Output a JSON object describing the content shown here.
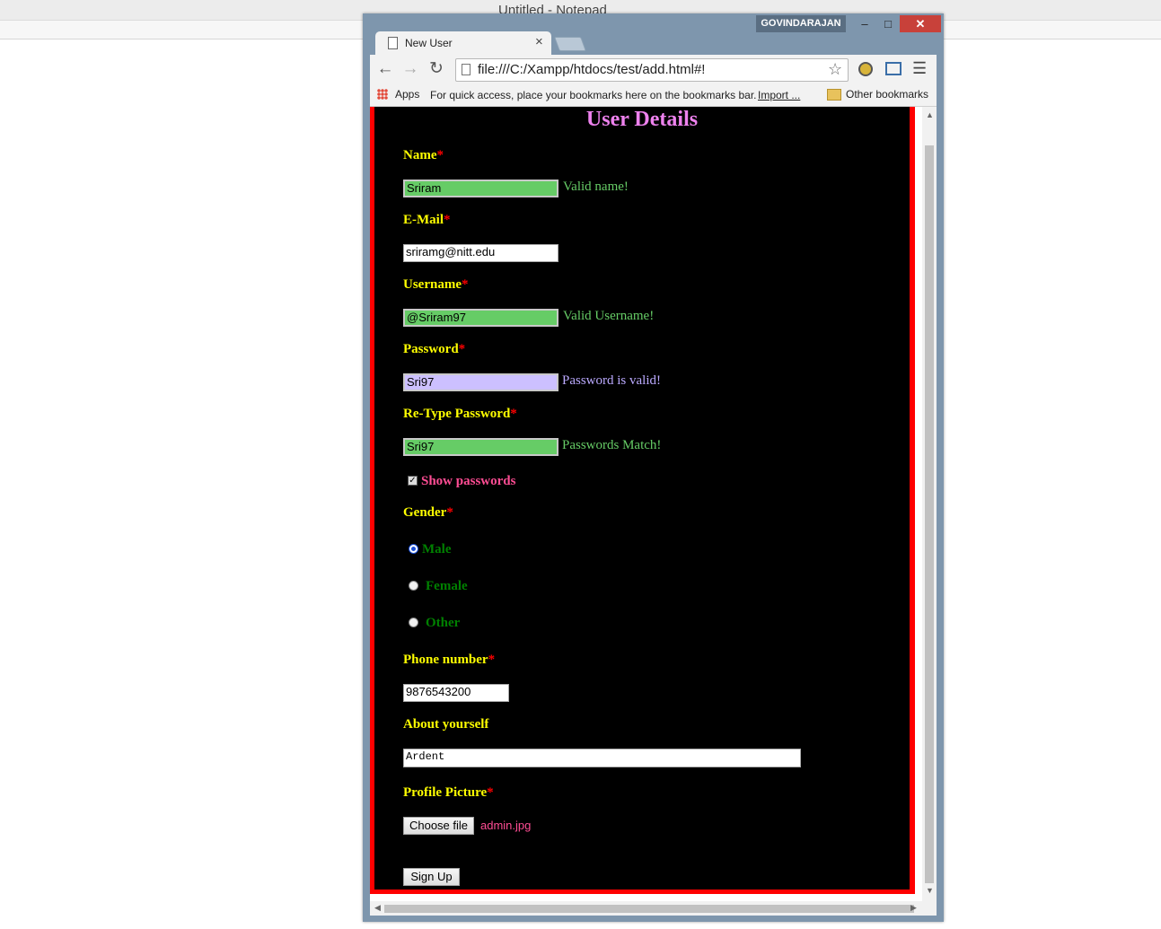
{
  "notepad": {
    "title": "Untitled - Notepad"
  },
  "window": {
    "user_badge": "GOVINDARAJAN",
    "minimize": "–",
    "maximize": "□",
    "close": "✕"
  },
  "tab": {
    "label": "New User",
    "close": "×"
  },
  "toolbar": {
    "url": "file:///C:/Xampp/htdocs/test/add.html#!"
  },
  "bookmarks": {
    "apps": "Apps",
    "hint": "For quick access, place your bookmarks here on the bookmarks bar.",
    "import": "Import ...",
    "other": "Other bookmarks"
  },
  "form": {
    "heading": "User Details",
    "required_mark": "*",
    "name": {
      "label": "Name",
      "value": "Sriram",
      "message": "Valid name!"
    },
    "email": {
      "label": "E-Mail",
      "value": "sriramg@nitt.edu"
    },
    "username": {
      "label": "Username",
      "value": "@Sriram97",
      "message": "Valid Username!"
    },
    "password": {
      "label": "Password",
      "value": "Sri97",
      "message": "Password is valid!"
    },
    "retype": {
      "label": "Re-Type Password",
      "value": "Sri97",
      "message": "Passwords Match!"
    },
    "show_passwords": {
      "label": "Show passwords",
      "checked": true
    },
    "gender": {
      "label": "Gender",
      "options": [
        "Male",
        "Female",
        "Other"
      ],
      "selected": "Male"
    },
    "phone": {
      "label": "Phone number",
      "value": "9876543200"
    },
    "about": {
      "label": "About yourself",
      "value": "Ardent"
    },
    "picture": {
      "label": "Profile Picture",
      "button": "Choose file",
      "file": "admin.jpg"
    },
    "submit": "Sign Up"
  },
  "colors": {
    "page_border": "#ff0000",
    "form_bg": "#000000",
    "heading": "#ee82ee",
    "label": "#ffff00",
    "valid": "#66cc66",
    "password_valid": "#ccc0ff",
    "gender_option": "#008000",
    "accent_pink": "#ff4d94"
  }
}
